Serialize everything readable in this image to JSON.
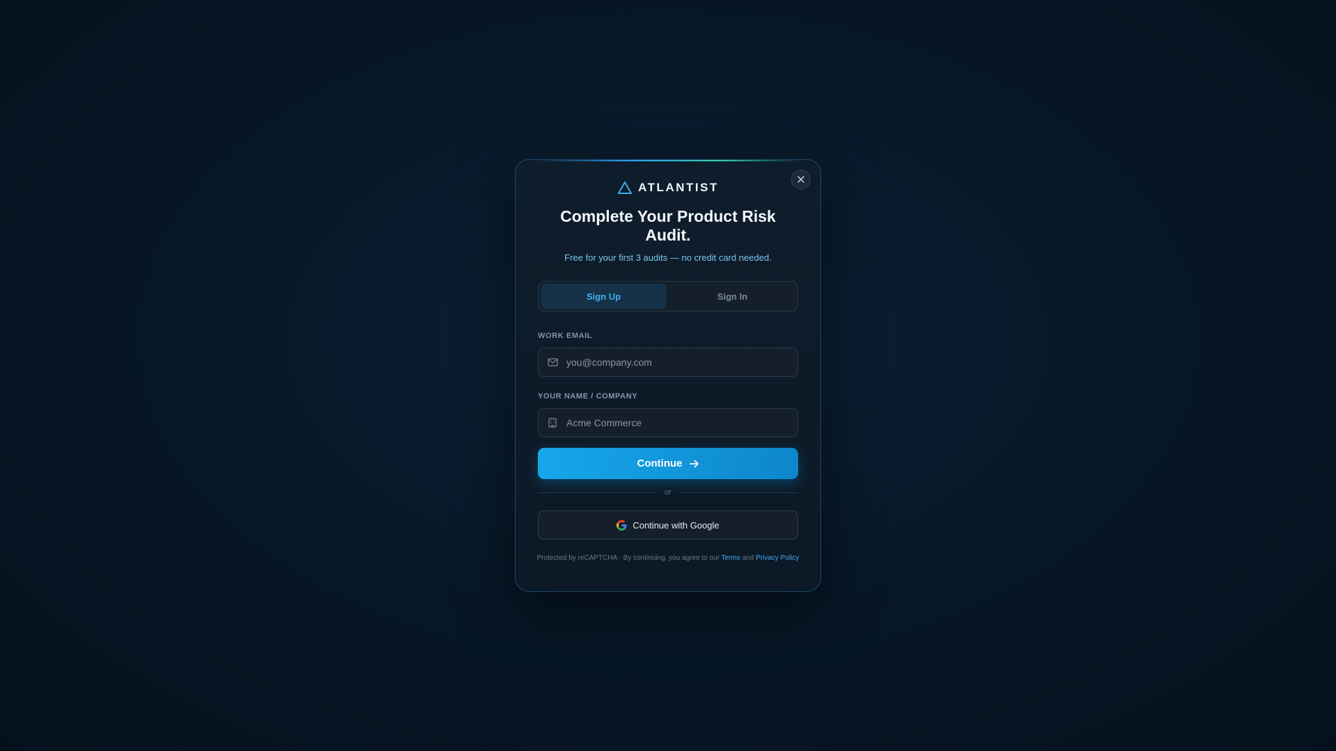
{
  "brand": {
    "name": "ATLANTIST",
    "accent_color": "#3fb0ef"
  },
  "modal": {
    "title": "Complete Your Product Risk Audit.",
    "subtitle": "Free for your first 3 audits — no credit card needed.",
    "close_icon": "close-icon"
  },
  "tabs": [
    {
      "label": "Sign Up",
      "active": true
    },
    {
      "label": "Sign In",
      "active": false
    }
  ],
  "form": {
    "email": {
      "label": "WORK EMAIL",
      "placeholder": "you@company.com",
      "value": "",
      "icon": "mail-icon"
    },
    "name_company": {
      "label": "YOUR NAME / COMPANY",
      "placeholder": "Acme Commerce",
      "value": "",
      "icon": "building-icon"
    },
    "continue_label": "Continue",
    "continue_icon": "arrow-right-icon",
    "button_color": "#16a7ea"
  },
  "divider_text": "or",
  "google": {
    "label": "Continue with Google",
    "icon": "google-icon"
  },
  "legal": {
    "prefix": "Protected by reCAPTCHA · By continuing, you agree to our",
    "terms": "Terms",
    "and": "and",
    "privacy": "Privacy Policy"
  }
}
